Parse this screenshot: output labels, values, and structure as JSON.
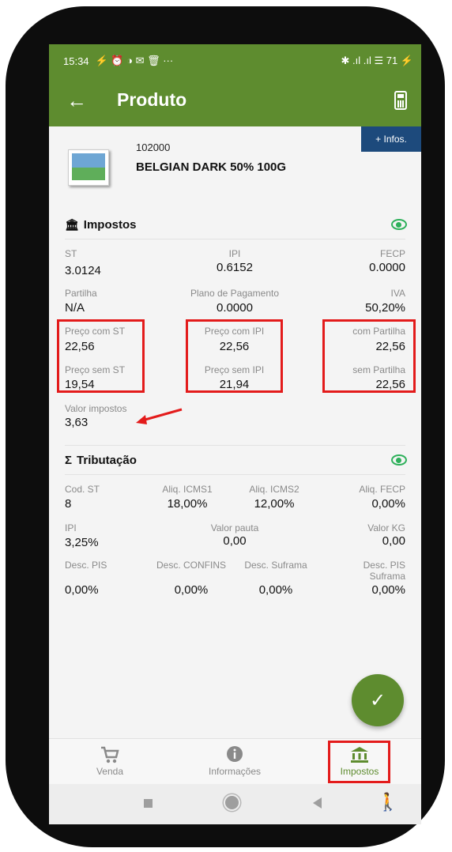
{
  "statusbar": {
    "time": "15:34",
    "left_icons": "⚡ ⏰ ◑ ✉ 🗑 ···",
    "right_icons": "✱ .ıl .ıl ☰ 71 ⚡"
  },
  "appbar": {
    "title": "Produto"
  },
  "infos_button": "+ Infos.",
  "product": {
    "code": "102000",
    "name": "BELGIAN DARK 50% 100G"
  },
  "impostos": {
    "title": "Impostos",
    "st_label": "ST",
    "st_value": "3.0124",
    "ipi_label": "IPI",
    "ipi_value": "0.6152",
    "fecp_label": "FECP",
    "fecp_value": "0.0000",
    "partilha_label": "Partilha",
    "partilha_value": "N/A",
    "plano_label": "Plano de Pagamento",
    "plano_value": "0.0000",
    "iva_label": "IVA",
    "iva_value": "50,20%",
    "preco_com_st_label": "Preço com ST",
    "preco_com_st_value": "22,56",
    "preco_com_ipi_label": "Preço com IPI",
    "preco_com_ipi_value": "22,56",
    "com_partilha_label": "com Partilha",
    "com_partilha_value": "22,56",
    "preco_sem_st_label": "Preço sem ST",
    "preco_sem_st_value": "19,54",
    "preco_sem_ipi_label": "Preço sem IPI",
    "preco_sem_ipi_value": "21,94",
    "sem_partilha_label": "sem Partilha",
    "sem_partilha_value": "22,56",
    "valor_impostos_label": "Valor impostos",
    "valor_impostos_value": "3,63"
  },
  "tributacao": {
    "title": "Tributação",
    "cod_st_label": "Cod. ST",
    "cod_st_value": "8",
    "aliq_icms1_label": "Aliq. ICMS1",
    "aliq_icms1_value": "18,00%",
    "aliq_icms2_label": "Aliq. ICMS2",
    "aliq_icms2_value": "12,00%",
    "aliq_fecp_label": "Aliq. FECP",
    "aliq_fecp_value": "0,00%",
    "ipi_label": "IPI",
    "ipi_value": "3,25%",
    "valor_pauta_label": "Valor pauta",
    "valor_pauta_value": "0,00",
    "valor_kg_label": "Valor KG",
    "valor_kg_value": "0,00",
    "desc_pis_label": "Desc. PIS",
    "desc_pis_value": "0,00%",
    "desc_confins_label": "Desc. CONFINS",
    "desc_confins_value": "0,00%",
    "desc_suframa_label": "Desc. Suframa",
    "desc_suframa_value": "0,00%",
    "desc_pis_suframa_label_1": "Desc. PIS",
    "desc_pis_suframa_label_2": "Suframa",
    "desc_pis_suframa_value": "0,00%"
  },
  "bottom_nav": [
    {
      "label": "Venda",
      "icon": "cart-icon"
    },
    {
      "label": "Informações",
      "icon": "info-icon"
    },
    {
      "label": "Impostos",
      "icon": "bank-icon"
    }
  ],
  "colors": {
    "primary": "#5e8c2f",
    "highlight": "#e31b1b",
    "infos": "#1d4a7c",
    "eye": "#2db05a"
  }
}
